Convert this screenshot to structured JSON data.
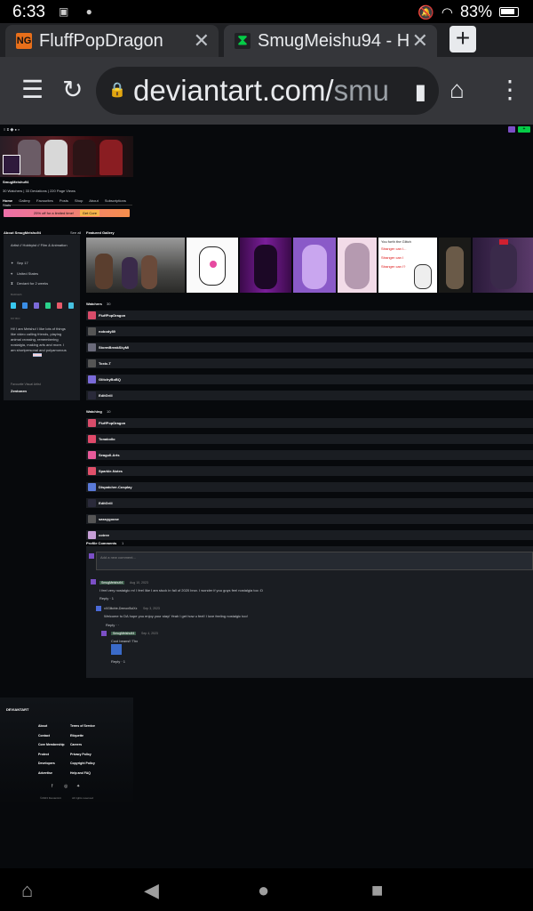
{
  "status_bar": {
    "time": "6:33",
    "battery": "83%"
  },
  "tabs": [
    {
      "title": "FluffPopDragon",
      "favicon": "NG"
    },
    {
      "title": "SmugMeishu94 - H",
      "favicon": "da-logo-icon"
    }
  ],
  "toolbar": {
    "url_main": "deviantart.com/",
    "url_rest": "smu"
  },
  "profile": {
    "username": "SmugMeishu94",
    "stats": "30 Watchers  |  33 Deviations  |  220 Page Views",
    "tabs": [
      "Home",
      "Gallery",
      "Favourites",
      "Posts",
      "Shop",
      "About",
      "Subscriptions",
      "Stats"
    ],
    "promo_text": "25% off for a limited time!",
    "promo_button": "Get Core"
  },
  "about": {
    "heading": "About SmugMeishu94",
    "see_all": "See all",
    "roles": "Artist  //  Hobbyist  //  Film & Animation",
    "birthday": "Sep 17",
    "country": "United States",
    "deviant_for": "Deviant for 2 weeks",
    "badges_label": "BADGES",
    "my_bio_label": "MY BIO",
    "bio": "Hi! I am Meishu! I like lots of things like video calling friends, playing animal crossing, remembering nostalgia, making arts and more. I am shortpersonal and polyamorous",
    "favourite_label": "Favourite Visual Artist",
    "favourite_value": "Zentonen"
  },
  "featured": {
    "heading": "Featured Gallery",
    "thumb_text": [
      "You forth the Glitch",
      "Stranger can I...",
      "Stranger can I",
      "Stranger can I?"
    ]
  },
  "watchers": {
    "heading": "Watchers",
    "count": "30",
    "items": [
      "FluffPopDragon",
      "nobody89",
      "StormBreakSkyMl",
      "Toxic-T",
      "GlitchyBoBQ",
      "EditGrill"
    ]
  },
  "watching": {
    "heading": "Watching",
    "count": "10",
    "items": [
      "FluffPopDragon",
      "Tonakollo",
      "Seagull-Arts",
      "Sparkle-Notes",
      "Dispatcher-Cosplay",
      "EditGrill",
      "sassygoose",
      "cotree"
    ]
  },
  "comments": {
    "heading": "Profile Comments",
    "count": "1",
    "placeholder": "Add a new comment...",
    "c1": {
      "author": "SmugMeishu94",
      "date": "Aug 10, 2023",
      "text": "I feel very nostalgic rn! I feel like I am stuck in fall of 2020 bruv. I wonder if you guys feel nostalgia too :D",
      "actions": "Reply  ·  1"
    },
    "c2": {
      "author": "xXGlitchie-DemonBoiXx",
      "date": "Sep 3, 2023",
      "text": "Welcome to DA hope you enjoy your stay! Yeah I get how u feel! I love feeling nostalgic too!",
      "actions": "Reply  ·  ·"
    },
    "c3": {
      "author": "SmugMeishu94",
      "date": "Sep 4, 2023",
      "text": "Cool beans!! Thx",
      "actions": "Reply  ·  1"
    }
  },
  "footer": {
    "logo": "DEVIANTART",
    "col1": [
      "About",
      "Contact",
      "Core Membership",
      "Protect",
      "Developers",
      "Advertise"
    ],
    "col2": [
      "Terms of Service",
      "Etiquette",
      "Careers",
      "Privacy Policy",
      "Copyright Policy",
      "Help and FAQ"
    ],
    "copyright": "©2023 DeviantArt",
    "rights": "All rights reserved"
  },
  "colors": {
    "page_bg": "#07090c",
    "card_bg": "#1a1d22",
    "accent_green": "#05cc47",
    "promo_start": "#ec6fa9",
    "promo_end": "#f58e4c"
  }
}
